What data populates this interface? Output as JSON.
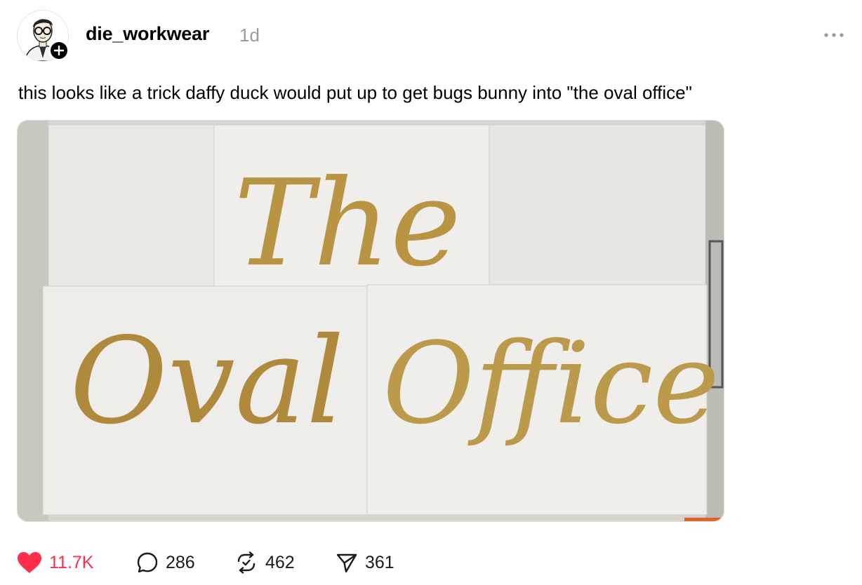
{
  "post": {
    "username": "die_workwear",
    "time_ago": "1d",
    "text": "this looks like a trick daffy duck would put up to get bugs bunny into \"the oval office\""
  },
  "media": {
    "sign_word_1": "The",
    "sign_word_2": "Oval",
    "sign_word_3": "Office",
    "lettering_color": "#b89443",
    "paper_color": "#efeeea",
    "wall_color": "#d9d8d2"
  },
  "actions": {
    "likes": "11.7K",
    "replies": "286",
    "reposts": "462",
    "shares": "361"
  },
  "colors": {
    "like_red": "#ff2e4c",
    "muted_gray": "#9a9a9a"
  },
  "icons": {
    "like": "heart-filled-icon",
    "reply": "speech-bubble-icon",
    "repost": "repost-check-icon",
    "share": "paper-plane-icon",
    "more": "ellipsis-icon",
    "follow": "plus-icon"
  }
}
